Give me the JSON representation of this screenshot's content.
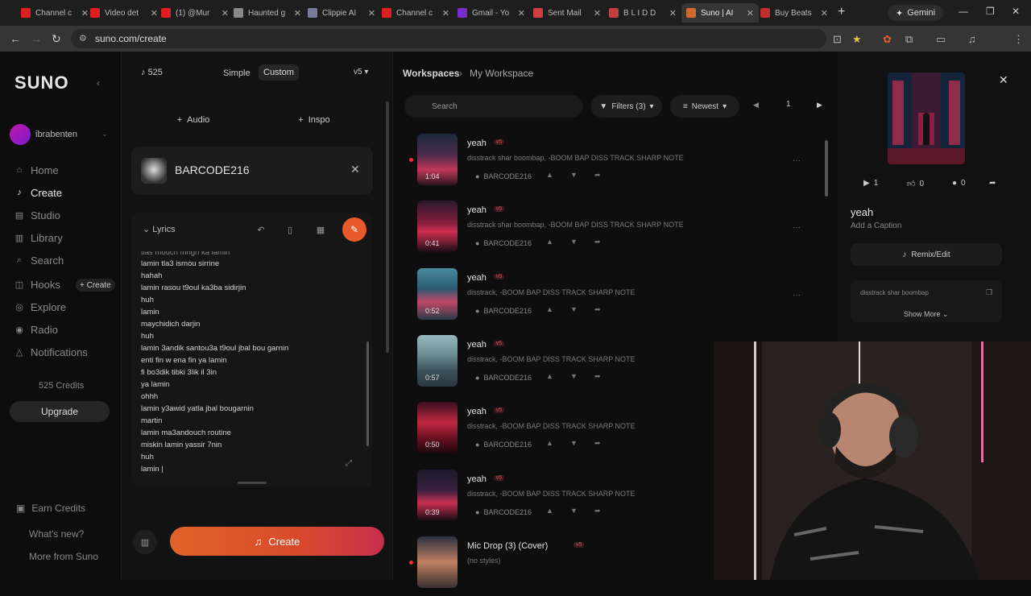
{
  "browser": {
    "tabs": [
      {
        "label": "Channel c",
        "color": "#e02020"
      },
      {
        "label": "Video det",
        "color": "#e02020"
      },
      {
        "label": "(1) @Mur",
        "color": "#e02020"
      },
      {
        "label": "Haunted g",
        "color": "#888888"
      },
      {
        "label": "Clippie AI",
        "color": "#7a7a9a"
      },
      {
        "label": "Channel c",
        "color": "#e02020"
      },
      {
        "label": "Gmail - Yo",
        "color": "#7a2bd0"
      },
      {
        "label": "Sent Mail",
        "color": "#d04040"
      },
      {
        "label": "B L I D D",
        "color": "#c04040"
      },
      {
        "label": "Suno | AI",
        "color": "#d06a30"
      },
      {
        "label": "Buy Beats",
        "color": "#c03030"
      }
    ],
    "new_tab": "+",
    "gemini": "Gemini",
    "url": "suno.com/create"
  },
  "nav": {
    "logo": "SUNO",
    "user": "ibrabenten",
    "items": [
      {
        "label": "Home",
        "icon": "home-icon",
        "glyph": "⌂"
      },
      {
        "label": "Create",
        "icon": "create-icon",
        "glyph": "♪"
      },
      {
        "label": "Studio",
        "icon": "studio-icon",
        "glyph": "▤"
      },
      {
        "label": "Library",
        "icon": "library-icon",
        "glyph": "▥"
      },
      {
        "label": "Search",
        "icon": "search-icon",
        "glyph": "⌕"
      },
      {
        "label": "Hooks",
        "icon": "hooks-icon",
        "glyph": "◫"
      },
      {
        "label": "Explore",
        "icon": "explore-icon",
        "glyph": "◎"
      },
      {
        "label": "Radio",
        "icon": "radio-icon",
        "glyph": "◉"
      },
      {
        "label": "Notifications",
        "icon": "bell-icon",
        "glyph": "△"
      }
    ],
    "hooks_create": "+ Create",
    "credits": "525 Credits",
    "upgrade": "Upgrade",
    "footer": [
      "Earn Credits",
      "What's new?",
      "More from Suno"
    ]
  },
  "create": {
    "credits": "525",
    "mode_simple": "Simple",
    "mode_custom": "Custom",
    "version": "v5",
    "audio": "Audio",
    "inspo": "Inspo",
    "persona": "BARCODE216",
    "lyrics_label": "Lyrics",
    "lyrics": [
      "tlas mouch mngri ka lamin",
      "lamin tla3 ismou sirrine",
      "hahah",
      "lamin rasou t9oul ka3ba sidirjin",
      "huh",
      "lamin",
      "maychidich darjin",
      "huh",
      "lamin 3andik santou3a t9oul jbal bou garnin",
      "enti fin w ena fin ya lamin",
      "fi bo3dik tibki 3lik il 3in",
      "ya lamin",
      "ohhh",
      "lamin y3awid yatla jbal bougarnin",
      "martin",
      "lamin ma3andouch routine",
      "miskin lamin yassir 7nin",
      "huh",
      "lamin |"
    ],
    "create_button": "Create"
  },
  "workspace": {
    "root": "Workspaces",
    "current": "My Workspace",
    "search_placeholder": "Search",
    "filters": "Filters (3)",
    "sort": "Newest",
    "page": "1",
    "songs": [
      {
        "title": "yeah",
        "badge": "v5",
        "desc": "disstrack shar boombap, -BOOM BAP DISS TRACK SHARP NOTE",
        "artist": "BARCODE216",
        "duration": "1:04"
      },
      {
        "title": "yeah",
        "badge": "v5",
        "desc": "disstrack shar boombap, -BOOM BAP DISS TRACK SHARP NOTE",
        "artist": "BARCODE216",
        "duration": "0:41"
      },
      {
        "title": "yeah",
        "badge": "v5",
        "desc": "disstrack, -BOOM BAP DISS TRACK SHARP NOTE",
        "artist": "BARCODE216",
        "duration": "0:52"
      },
      {
        "title": "yeah",
        "badge": "v5",
        "desc": "disstrack, -BOOM BAP DISS TRACK SHARP NOTE",
        "artist": "BARCODE216",
        "duration": "0:57"
      },
      {
        "title": "yeah",
        "badge": "v5",
        "desc": "disstrack, -BOOM BAP DISS TRACK SHARP NOTE",
        "artist": "BARCODE216",
        "duration": "0:50"
      },
      {
        "title": "yeah",
        "badge": "v5",
        "desc": "disstrack, -BOOM BAP DISS TRACK SHARP NOTE",
        "artist": "BARCODE216",
        "duration": "0:39"
      },
      {
        "title": "Mic Drop (3) (Cover)",
        "badge": "v5",
        "desc": "(no styles)",
        "artist": "",
        "duration": ""
      }
    ]
  },
  "detail": {
    "plays": "1",
    "likes": "0",
    "comments": "0",
    "title": "yeah",
    "caption": "Add a Caption",
    "remix": "Remix/Edit",
    "style": "disstrack shar boombap",
    "show_more": "Show More"
  },
  "colors": {
    "accent": "#e85a2a",
    "create_gradient_start": "#e0642a",
    "create_gradient_end": "#c7304a"
  }
}
